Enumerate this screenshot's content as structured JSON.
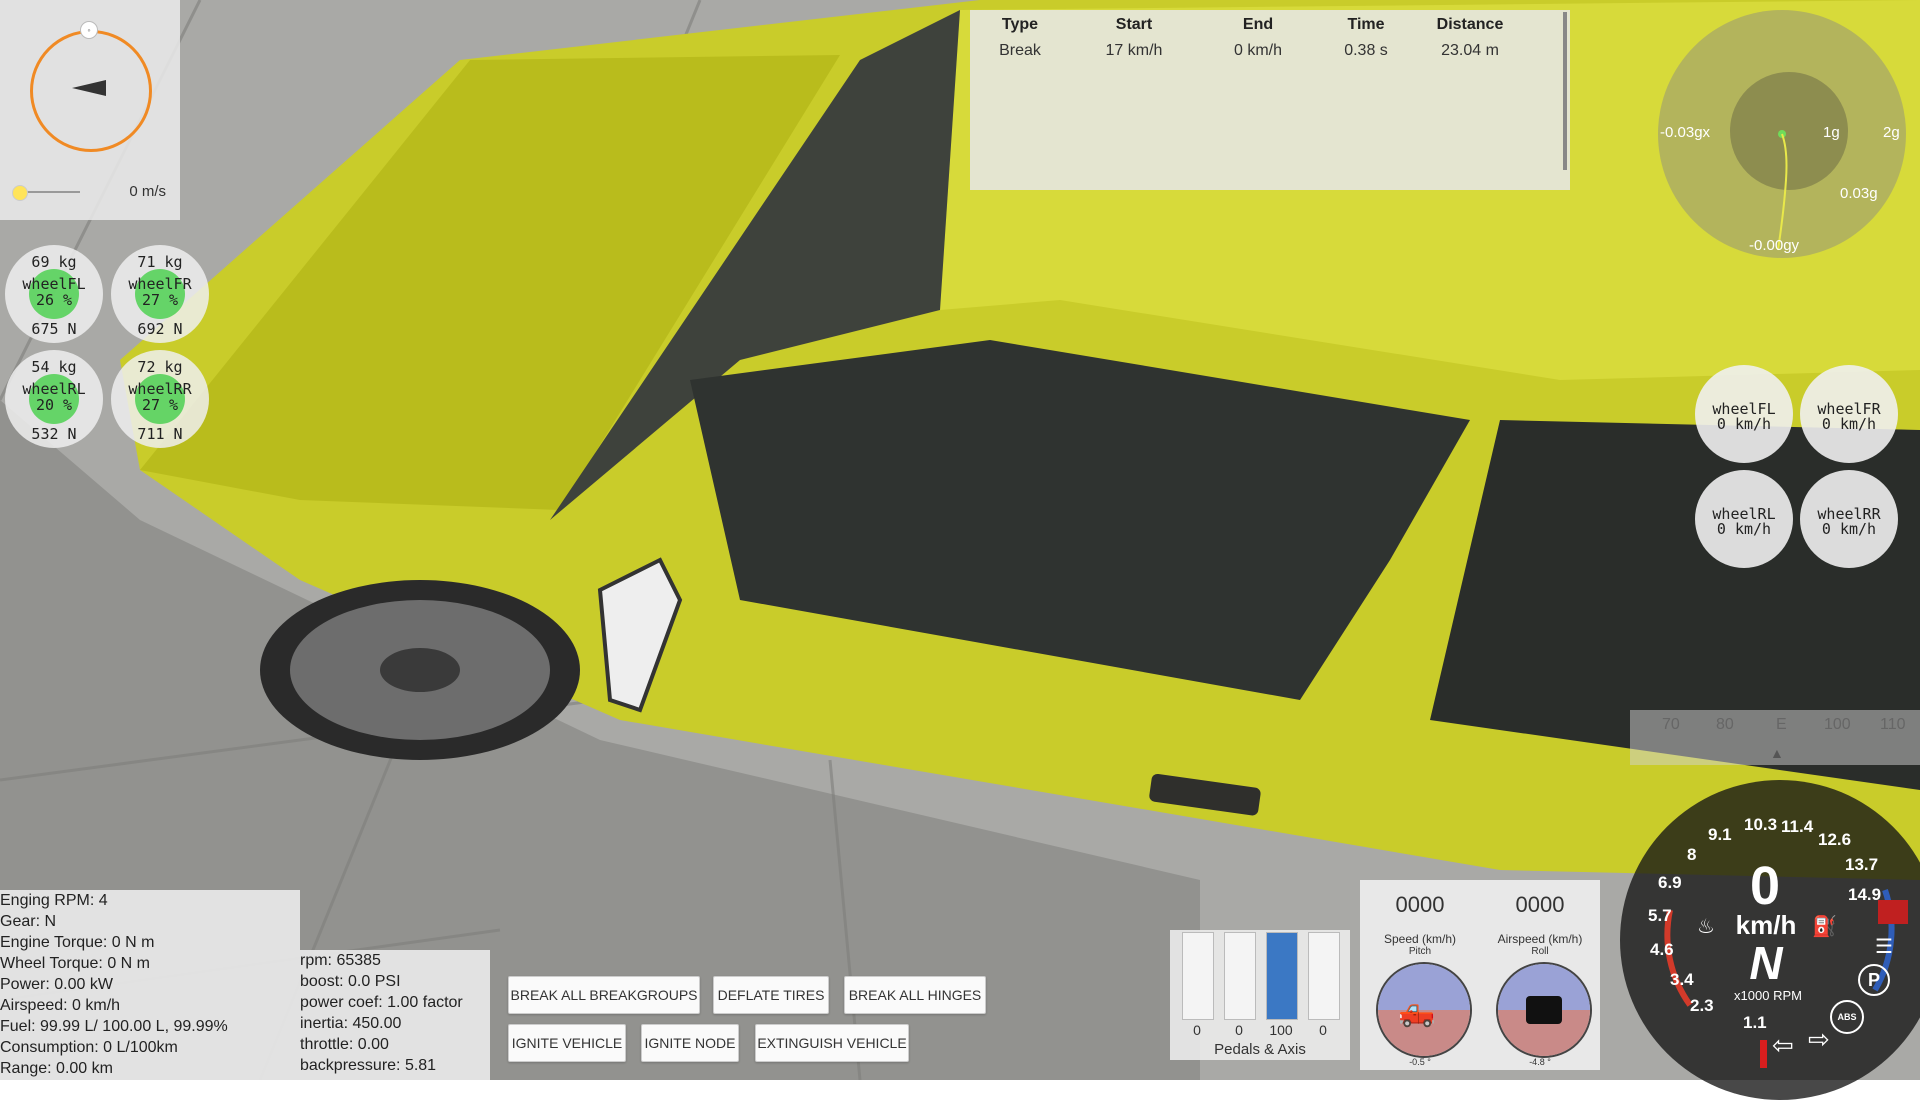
{
  "colors": {
    "car_body": "#c9cc2a",
    "accent_orange": "#f08a24",
    "wheel_load_green": "#56d15a",
    "pedal_blue": "#3b78c4"
  },
  "compass": {
    "north_marker": "◦",
    "speed": "0 m/s"
  },
  "wheel_loads": [
    {
      "id": "FL",
      "mass": "69 kg",
      "name": "wheelFL",
      "pct": "26 %",
      "force": "675 N"
    },
    {
      "id": "FR",
      "mass": "71 kg",
      "name": "wheelFR",
      "pct": "27 %",
      "force": "692 N"
    },
    {
      "id": "RL",
      "mass": "54 kg",
      "name": "wheelRL",
      "pct": "20 %",
      "force": "532 N"
    },
    {
      "id": "RR",
      "mass": "72 kg",
      "name": "wheelRR",
      "pct": "27 %",
      "force": "711 N"
    }
  ],
  "brake_table": {
    "headers": [
      "Type",
      "Start",
      "End",
      "Time",
      "Distance"
    ],
    "rows": [
      [
        "Break",
        "17 km/h",
        "0 km/h",
        "0.38 s",
        "23.04 m"
      ]
    ]
  },
  "gforce": {
    "left": "-0.03gx",
    "ring1": "1g",
    "ring2": "2g",
    "right": "0.03g",
    "bottom": "-0.00gy"
  },
  "wheel_speeds": [
    {
      "name": "wheelFL",
      "speed": "0 km/h"
    },
    {
      "name": "wheelFR",
      "speed": "0 km/h"
    },
    {
      "name": "wheelRL",
      "speed": "0 km/h"
    },
    {
      "name": "wheelRR",
      "speed": "0 km/h"
    }
  ],
  "heading_tape": [
    "70",
    "80",
    "E",
    "100",
    "110"
  ],
  "tacho": {
    "ticks": [
      "1.1",
      "2.3",
      "3.4",
      "4.6",
      "5.7",
      "6.9",
      "8",
      "9.1",
      "10.3",
      "11.4",
      "12.6",
      "13.7",
      "14.9"
    ],
    "speed": "0",
    "unit": "km/h",
    "gear": "N",
    "rpm_label": "x1000 RPM",
    "parking_icon": "P",
    "abs_icon": "ABS"
  },
  "engine_info": [
    "Enging RPM: 4",
    "Gear: N",
    "Engine Torque: 0 N m",
    "Wheel Torque: 0 N m",
    "Power: 0.00 kW",
    "Airspeed: 0 km/h",
    "Fuel: 99.99 L/ 100.00 L, 99.99%",
    "Consumption: 0 L/100km",
    "Range: 0.00 km"
  ],
  "extra_info": [
    "rpm: 65385",
    "boost: 0.0 PSI",
    "power coef: 1.00 factor",
    "inertia: 450.00",
    "throttle: 0.00",
    "backpressure: 5.81"
  ],
  "buttons": {
    "break_breakgroups": "BREAK ALL BREAKGROUPS",
    "deflate_tires": "DEFLATE TIRES",
    "break_hinges": "BREAK ALL HINGES",
    "ignite_vehicle": "IGNITE VEHICLE",
    "ignite_node": "IGNITE NODE",
    "extinguish_vehicle": "EXTINGUISH VEHICLE"
  },
  "pedals": {
    "values": [
      "0",
      "0",
      "100",
      "0"
    ],
    "levels": [
      0,
      0,
      1,
      0
    ],
    "title": "Pedals & Axis"
  },
  "attitude": {
    "speed_value": "0000",
    "speed_label": "Speed (km/h)",
    "airspeed_value": "0000",
    "airspeed_label": "Airspeed (km/h)",
    "pitch_label": "Pitch",
    "roll_label": "Roll",
    "pitch_value": "-0.5 °",
    "roll_value": "-4.8 °"
  }
}
